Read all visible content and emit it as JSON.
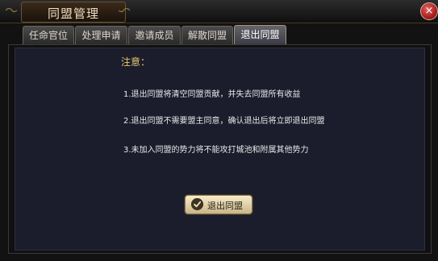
{
  "window": {
    "title": "同盟管理",
    "close_label": "×"
  },
  "tabs": [
    {
      "label": "任命官位",
      "active": false
    },
    {
      "label": "处理申请",
      "active": false
    },
    {
      "label": "邀请成员",
      "active": false
    },
    {
      "label": "解散同盟",
      "active": false
    },
    {
      "label": "退出同盟",
      "active": true
    }
  ],
  "notice": {
    "title": "注意：",
    "items": [
      "1.退出同盟将清空同盟贡献，并失去同盟所有收益",
      "2.退出同盟不需要盟主同意，确认退出后将立即退出同盟",
      "3.未加入同盟的势力将不能攻打城池和附属其他势力"
    ]
  },
  "actions": {
    "quit_button": {
      "label": "退出同盟",
      "icon": "check-icon"
    }
  },
  "colors": {
    "notice_title": "#e6c96a",
    "panel": "#1b1d2c",
    "close": "#b22222"
  }
}
